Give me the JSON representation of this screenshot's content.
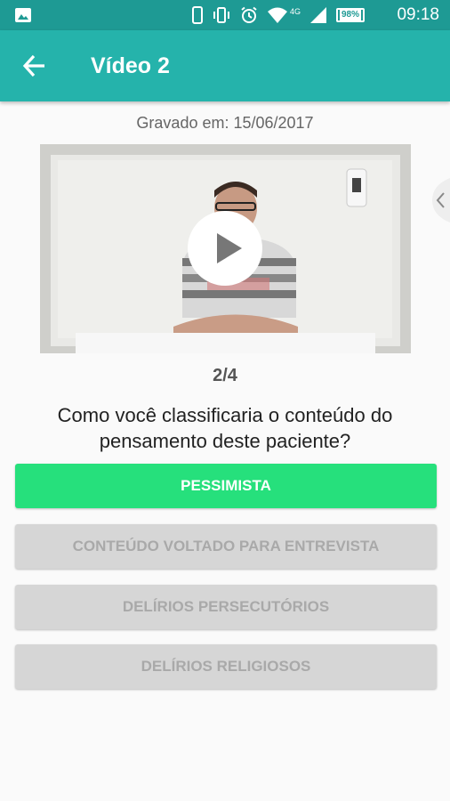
{
  "status_bar": {
    "time": "09:18",
    "battery": "98%",
    "network": "4G",
    "icons": [
      "image-icon",
      "phone-icon",
      "vibrate-icon",
      "alarm-icon",
      "wifi-icon",
      "signal-icon",
      "battery-icon"
    ]
  },
  "app_bar": {
    "title": "Vídeo 2"
  },
  "recorded_label": "Gravado em: 15/06/2017",
  "counter": "2/4",
  "question": "Como você classificaria o conteúdo do pensamento deste paciente?",
  "options": [
    {
      "label": "PESSIMISTA",
      "state": "selected"
    },
    {
      "label": "CONTEÚDO VOLTADO PARA ENTREVISTA",
      "state": "disabled"
    },
    {
      "label": "DELÍRIOS PERSECUTÓRIOS",
      "state": "disabled"
    },
    {
      "label": "DELÍRIOS RELIGIOSOS",
      "state": "disabled"
    }
  ],
  "colors": {
    "status_bar": "#1e9a94",
    "app_bar": "#25b3ab",
    "selected_option": "#26e07c",
    "disabled_option": "#d6d6d6"
  }
}
